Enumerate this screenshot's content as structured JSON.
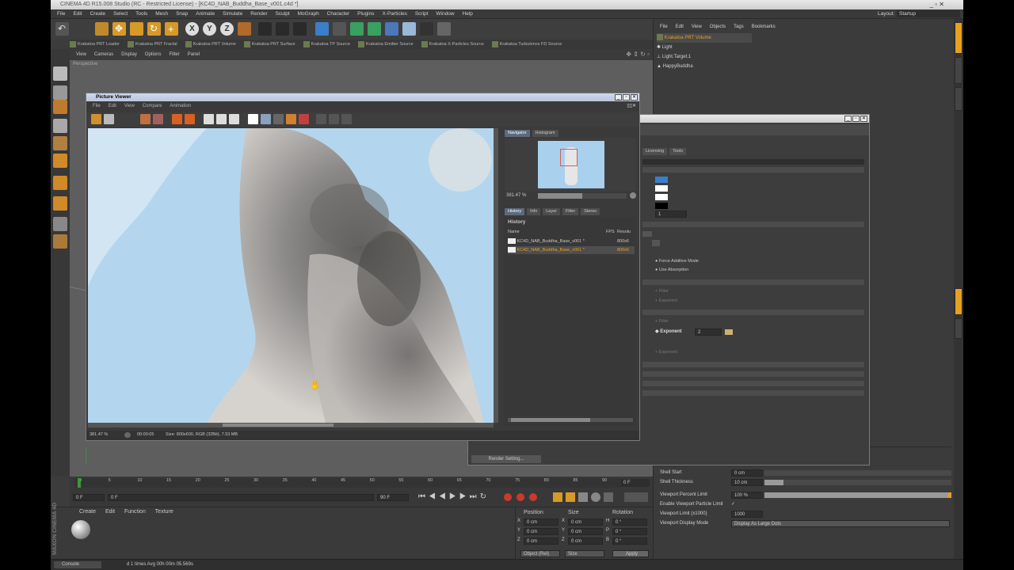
{
  "app": {
    "title": "CINEMA 4D R15.008 Studio (RC - Restricted License) - [KC4D_NAB_Buddha_Base_v001.c4d *]",
    "layout_label": "Layout:",
    "layout_value": "Startup"
  },
  "menubar": [
    "File",
    "Edit",
    "Create",
    "Select",
    "Tools",
    "Mesh",
    "Snap",
    "Animate",
    "Simulate",
    "Render",
    "Sculpt",
    "MoGraph",
    "Character",
    "Plugins",
    "X-Particles",
    "Script",
    "Window",
    "Help"
  ],
  "toolbar_axis": [
    "X",
    "Y",
    "Z"
  ],
  "plugins": [
    "Krakatoa PRT Loader",
    "Krakatoa PRT Fractal",
    "Krakatoa PRT Volume",
    "Krakatoa PRT Surface",
    "Krakatoa TP Source",
    "Krakatoa Emitter Source",
    "Krakatoa X-Particles Source",
    "Krakatoa Turbulence FD Source"
  ],
  "viewport": {
    "menu": [
      "View",
      "Cameras",
      "Display",
      "Options",
      "Filter",
      "Panel"
    ],
    "label": "Perspective"
  },
  "object_manager": {
    "menu": [
      "File",
      "Edit",
      "View",
      "Objects",
      "Tags",
      "Bookmarks"
    ],
    "objects": [
      {
        "name": "Krakatoa PRT Volume",
        "selected": true
      },
      {
        "name": "Light",
        "selected": false
      },
      {
        "name": "Light.Target.1",
        "selected": false
      },
      {
        "name": "HappyBuddha",
        "selected": false
      }
    ]
  },
  "attributes": {
    "shell_start_label": "Shell Start",
    "shell_start_value": "0 cm",
    "shell_thickness_label": "Shell Thickness",
    "shell_thickness_value": "10 cm",
    "viewport_percent_label": "Viewport Percent Limit",
    "viewport_percent_value": "100 %",
    "viewport_percent_fill": 1.0,
    "enable_viewport_label": "Enable Viewport Particle Limit",
    "enable_viewport_check": "✓",
    "viewport_limit_label": "Viewport Limit (x1000)",
    "viewport_limit_value": "1000",
    "viewport_display_label": "Viewport Display Mode",
    "viewport_display_value": "Display As Large Dots"
  },
  "render_settings_dialog": {
    "tabs": [
      "Licensing",
      "Tools"
    ],
    "force_additive": "Force Additive Mode",
    "use_absorption": "Use Absorption",
    "filter1": "Filter",
    "exponent_dim1": "Exponent",
    "filter2": "Filter",
    "exponent_label": "Exponent",
    "exponent_value": "2",
    "exponent_dim2": "Exponent",
    "spin_value": "1",
    "render_button": "Render Setting..."
  },
  "picture_viewer": {
    "title": "Picture Viewer",
    "menu": [
      "File",
      "Edit",
      "View",
      "Compare",
      "Animation"
    ],
    "nav_tabs": [
      "Navigator",
      "Histogram"
    ],
    "zoom": "381.47 %",
    "hist_tabs": [
      "History",
      "Info",
      "Layer",
      "Filter",
      "Stereo"
    ],
    "history_title": "History",
    "columns": [
      "Name",
      "FPS",
      "Resolu"
    ],
    "rows": [
      {
        "name": "KC4D_NAB_Buddha_Base_v001 *",
        "res": "800x6",
        "active": false
      },
      {
        "name": "KC4D_NAB_Buddha_Base_v001 *",
        "res": "800x6",
        "active": true
      }
    ],
    "status_zoom": "381.47 %",
    "status_time": "00:00:05",
    "status_info": "Size: 800x600, RGB (32Bit), 7.53 MB"
  },
  "timeline": {
    "ticks": [
      "0",
      "5",
      "10",
      "15",
      "20",
      "25",
      "30",
      "35",
      "40",
      "45",
      "50",
      "55",
      "60",
      "65",
      "70",
      "75",
      "80",
      "85",
      "90"
    ],
    "current_frame": "0 F",
    "start_frame": "0 F",
    "min_field": "0 F",
    "end_field": "90 F",
    "max_field": "90 F"
  },
  "material_manager": {
    "menu": [
      "Create",
      "Edit",
      "Function",
      "Texture"
    ],
    "brand": "MAXON CINEMA 4D"
  },
  "coordinates": {
    "headers": [
      "Position",
      "Size",
      "Rotation"
    ],
    "rows": [
      {
        "axis": "X",
        "pos": "0 cm",
        "saxis": "X",
        "size": "0 cm",
        "raxis": "H",
        "rot": "0 °"
      },
      {
        "axis": "Y",
        "pos": "0 cm",
        "saxis": "Y",
        "size": "0 cm",
        "raxis": "P",
        "rot": "0 °"
      },
      {
        "axis": "Z",
        "pos": "0 cm",
        "saxis": "Z",
        "size": "0 cm",
        "raxis": "B",
        "rot": "0 °"
      }
    ],
    "mode1": "Object (Rel)",
    "mode2": "Size",
    "apply": "Apply"
  },
  "status": {
    "console": "Console",
    "message": "d 1 times Avg 00h 00m 05.569s"
  },
  "colors": {
    "accent_orange": "#e8a020",
    "selection_blue": "#5c6a7c",
    "ui_dark": "#3c3c3c"
  }
}
